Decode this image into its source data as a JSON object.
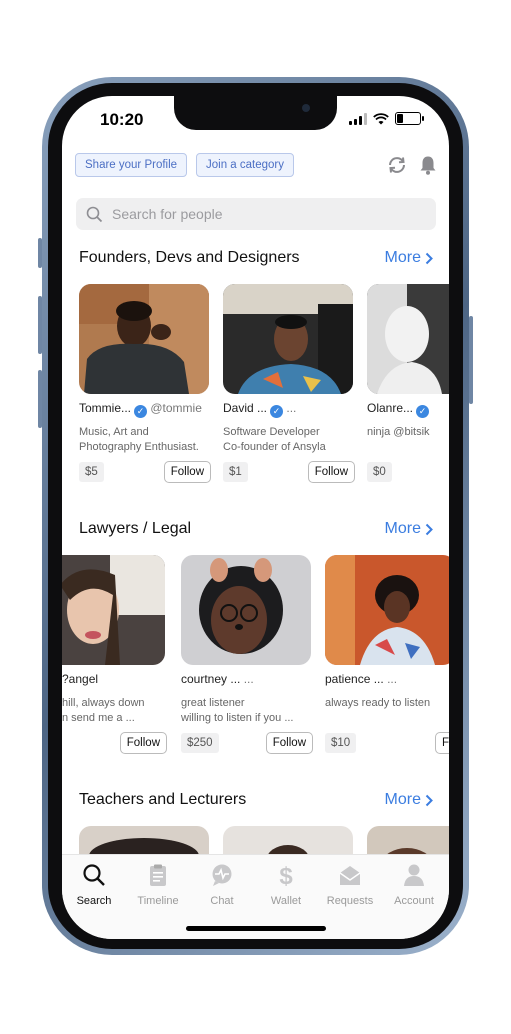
{
  "status_bar": {
    "time": "10:20"
  },
  "top_chips": {
    "share": "Share your Profile",
    "join": "Join a category"
  },
  "search": {
    "placeholder": "Search for people"
  },
  "sections": [
    {
      "title": "Founders, Devs and Designers",
      "more": "More",
      "cards": [
        {
          "name": "Tommie...",
          "handle": "@tommie",
          "desc": "Music, Art and\nPhotography Enthusiast.",
          "price": "$5",
          "follow": "Follow"
        },
        {
          "name": "David ...",
          "handle": "...",
          "desc": "Software Developer\nCo-founder of Ansyla",
          "price": "$1",
          "follow": "Follow"
        },
        {
          "name": "Olanre...",
          "handle": "",
          "desc": "ninja @bitsik",
          "price": "$0",
          "follow": ""
        }
      ]
    },
    {
      "title": "Lawyers / Legal",
      "more": "More",
      "cards": [
        {
          "name": "?angel",
          "handle": "",
          "desc": "hill, always down\nn send me a ...",
          "price": "",
          "follow": "Follow"
        },
        {
          "name": "courtney ...",
          "handle": "...",
          "desc": "great listener\nwilling to listen if you ...",
          "price": "$250",
          "follow": "Follow"
        },
        {
          "name": "patience ...",
          "handle": "...",
          "desc": "always ready to listen",
          "price": "$10",
          "follow": "Fol"
        }
      ]
    },
    {
      "title": "Teachers and Lecturers",
      "more": "More"
    }
  ],
  "tabs": [
    {
      "label": "Search",
      "icon": "search-icon"
    },
    {
      "label": "Timeline",
      "icon": "clipboard-icon"
    },
    {
      "label": "Chat",
      "icon": "chat-icon"
    },
    {
      "label": "Wallet",
      "icon": "dollar-icon"
    },
    {
      "label": "Requests",
      "icon": "envelope-icon"
    },
    {
      "label": "Account",
      "icon": "person-icon"
    }
  ],
  "colors": {
    "accent": "#3b7de0",
    "chip_text": "#4c6fc4",
    "verified": "#3b87e0"
  }
}
